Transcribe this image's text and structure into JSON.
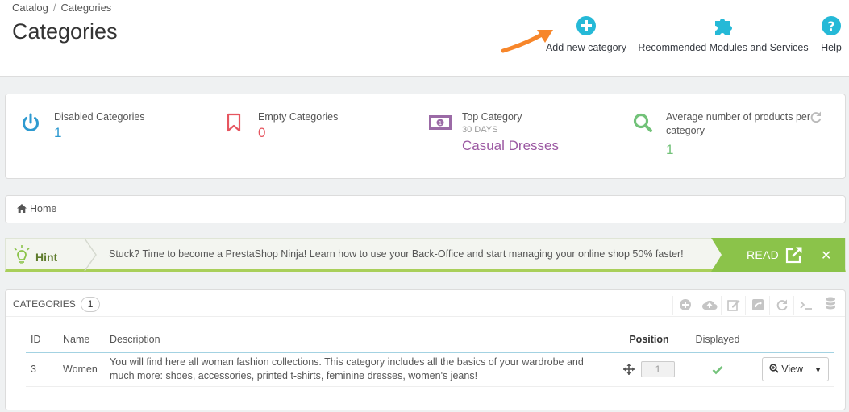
{
  "breadcrumb": {
    "section": "Catalog",
    "current": "Categories"
  },
  "page_title": "Categories",
  "toolbar": {
    "add_label": "Add new category",
    "modules_label": "Recommended Modules and Services",
    "help_label": "Help"
  },
  "kpis": {
    "disabled": {
      "title": "Disabled Categories",
      "value": "1"
    },
    "empty": {
      "title": "Empty Categories",
      "value": "0"
    },
    "top": {
      "title": "Top Category",
      "subtitle": "30 DAYS",
      "value": "Casual Dresses"
    },
    "average": {
      "title": "Average number of products per category",
      "value": "1"
    }
  },
  "tree": {
    "home_label": "Home"
  },
  "hint": {
    "label": "Hint",
    "text": "Stuck? Time to become a PrestaShop Ninja! Learn how to use your Back-Office and start managing your online shop 50% faster!",
    "read_label": "READ",
    "close_label": "✕"
  },
  "categories_panel": {
    "title": "CATEGORIES",
    "count": "1",
    "columns": {
      "id": "ID",
      "name": "Name",
      "description": "Description",
      "position": "Position",
      "displayed": "Displayed"
    },
    "rows": [
      {
        "id": "3",
        "name": "Women",
        "description": "You will find here all woman fashion collections. This category includes all the basics of your wardrobe and much more: shoes, accessories, printed t-shirts, feminine dresses, women's jeans!",
        "position": "1",
        "displayed_icon": "check-icon",
        "view_label": "View"
      }
    ]
  },
  "colors": {
    "accent_blue": "#25b9d7",
    "disabled_icon": "#2e9ad0",
    "empty_icon": "#e6555f",
    "top_icon": "#9b6aa6",
    "top_value": "#9b58a2",
    "average_icon": "#72c279",
    "hint_green": "#8bc34a",
    "arrow_orange": "#f7862a"
  }
}
